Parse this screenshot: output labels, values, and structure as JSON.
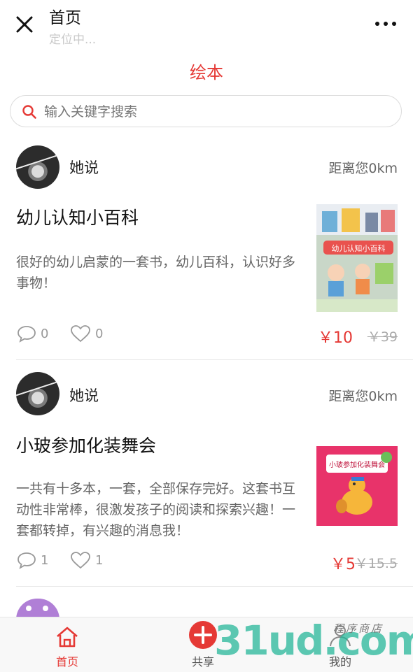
{
  "header": {
    "title": "首页",
    "subtitle": "定位中..."
  },
  "category": {
    "title": "绘本"
  },
  "search": {
    "placeholder": "输入关键字搜索"
  },
  "posts": [
    {
      "user": "她说",
      "distance": "距离您0km",
      "title": "幼儿认知小百科",
      "description": "很好的幼儿启蒙的一套书，幼儿百科，认识好多事物！",
      "comments": "0",
      "likes": "0",
      "price": "￥10",
      "original_price": "￥39",
      "cover_text": "幼儿认知小百科"
    },
    {
      "user": "她说",
      "distance": "距离您0km",
      "title": "小玻参加化装舞会",
      "description": "一共有十多本，一套，全部保存完好。这套书互动性非常棒，很激发孩子的阅读和探索兴趣！一套都转掉，有兴趣的消息我！",
      "comments": "1",
      "likes": "1",
      "price": "￥5",
      "original_price": "￥15.5",
      "cover_text": "小玻参加化装舞会"
    }
  ],
  "nav": [
    {
      "label": "首页",
      "icon": "home-icon",
      "active": true
    },
    {
      "label": "共享",
      "icon": "plus-circle-icon",
      "active": false
    },
    {
      "label": "我的",
      "icon": "user-icon",
      "active": false
    }
  ],
  "watermark": {
    "text": "31ud.com",
    "badge": "程序商店"
  },
  "colors": {
    "accent": "#e53935",
    "muted": "#999999",
    "border": "#e6e6e6"
  }
}
